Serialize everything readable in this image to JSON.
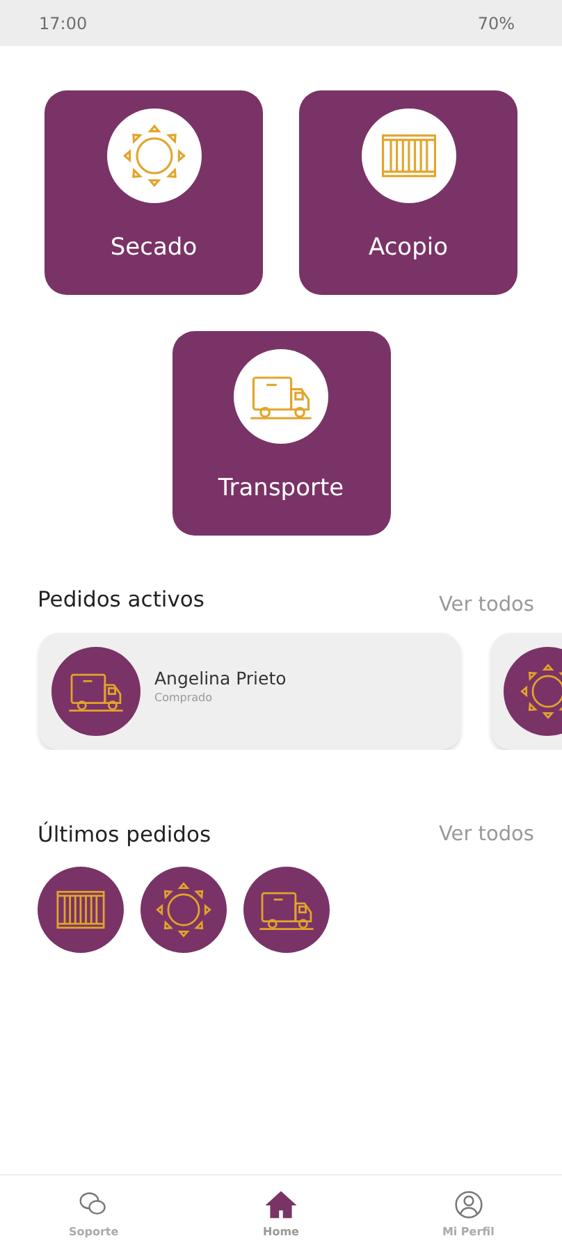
{
  "status_bar": {
    "time": "17:00",
    "battery": "70%"
  },
  "services": [
    {
      "label": "Secado",
      "kind": "sun"
    },
    {
      "label": "Acopio",
      "kind": "container"
    },
    {
      "label": "Transporte",
      "kind": "truck"
    }
  ],
  "active_orders": {
    "title": "Pedidos activos",
    "link": "Ver todos",
    "items": [
      {
        "kind": "truck",
        "name": "Angelina Prieto",
        "status": "Comprado"
      },
      {
        "kind": "sun"
      }
    ]
  },
  "recent_orders": {
    "title": "Últimos pedidos",
    "link": "Ver todos",
    "items": [
      {
        "kind": "container"
      },
      {
        "kind": "sun"
      },
      {
        "kind": "truck"
      }
    ]
  },
  "nav": [
    {
      "label": "Soporte",
      "kind": "chat",
      "selected": false
    },
    {
      "label": "Home",
      "kind": "home",
      "selected": true
    },
    {
      "label": "Mi Perfil",
      "kind": "profile",
      "selected": false
    }
  ]
}
